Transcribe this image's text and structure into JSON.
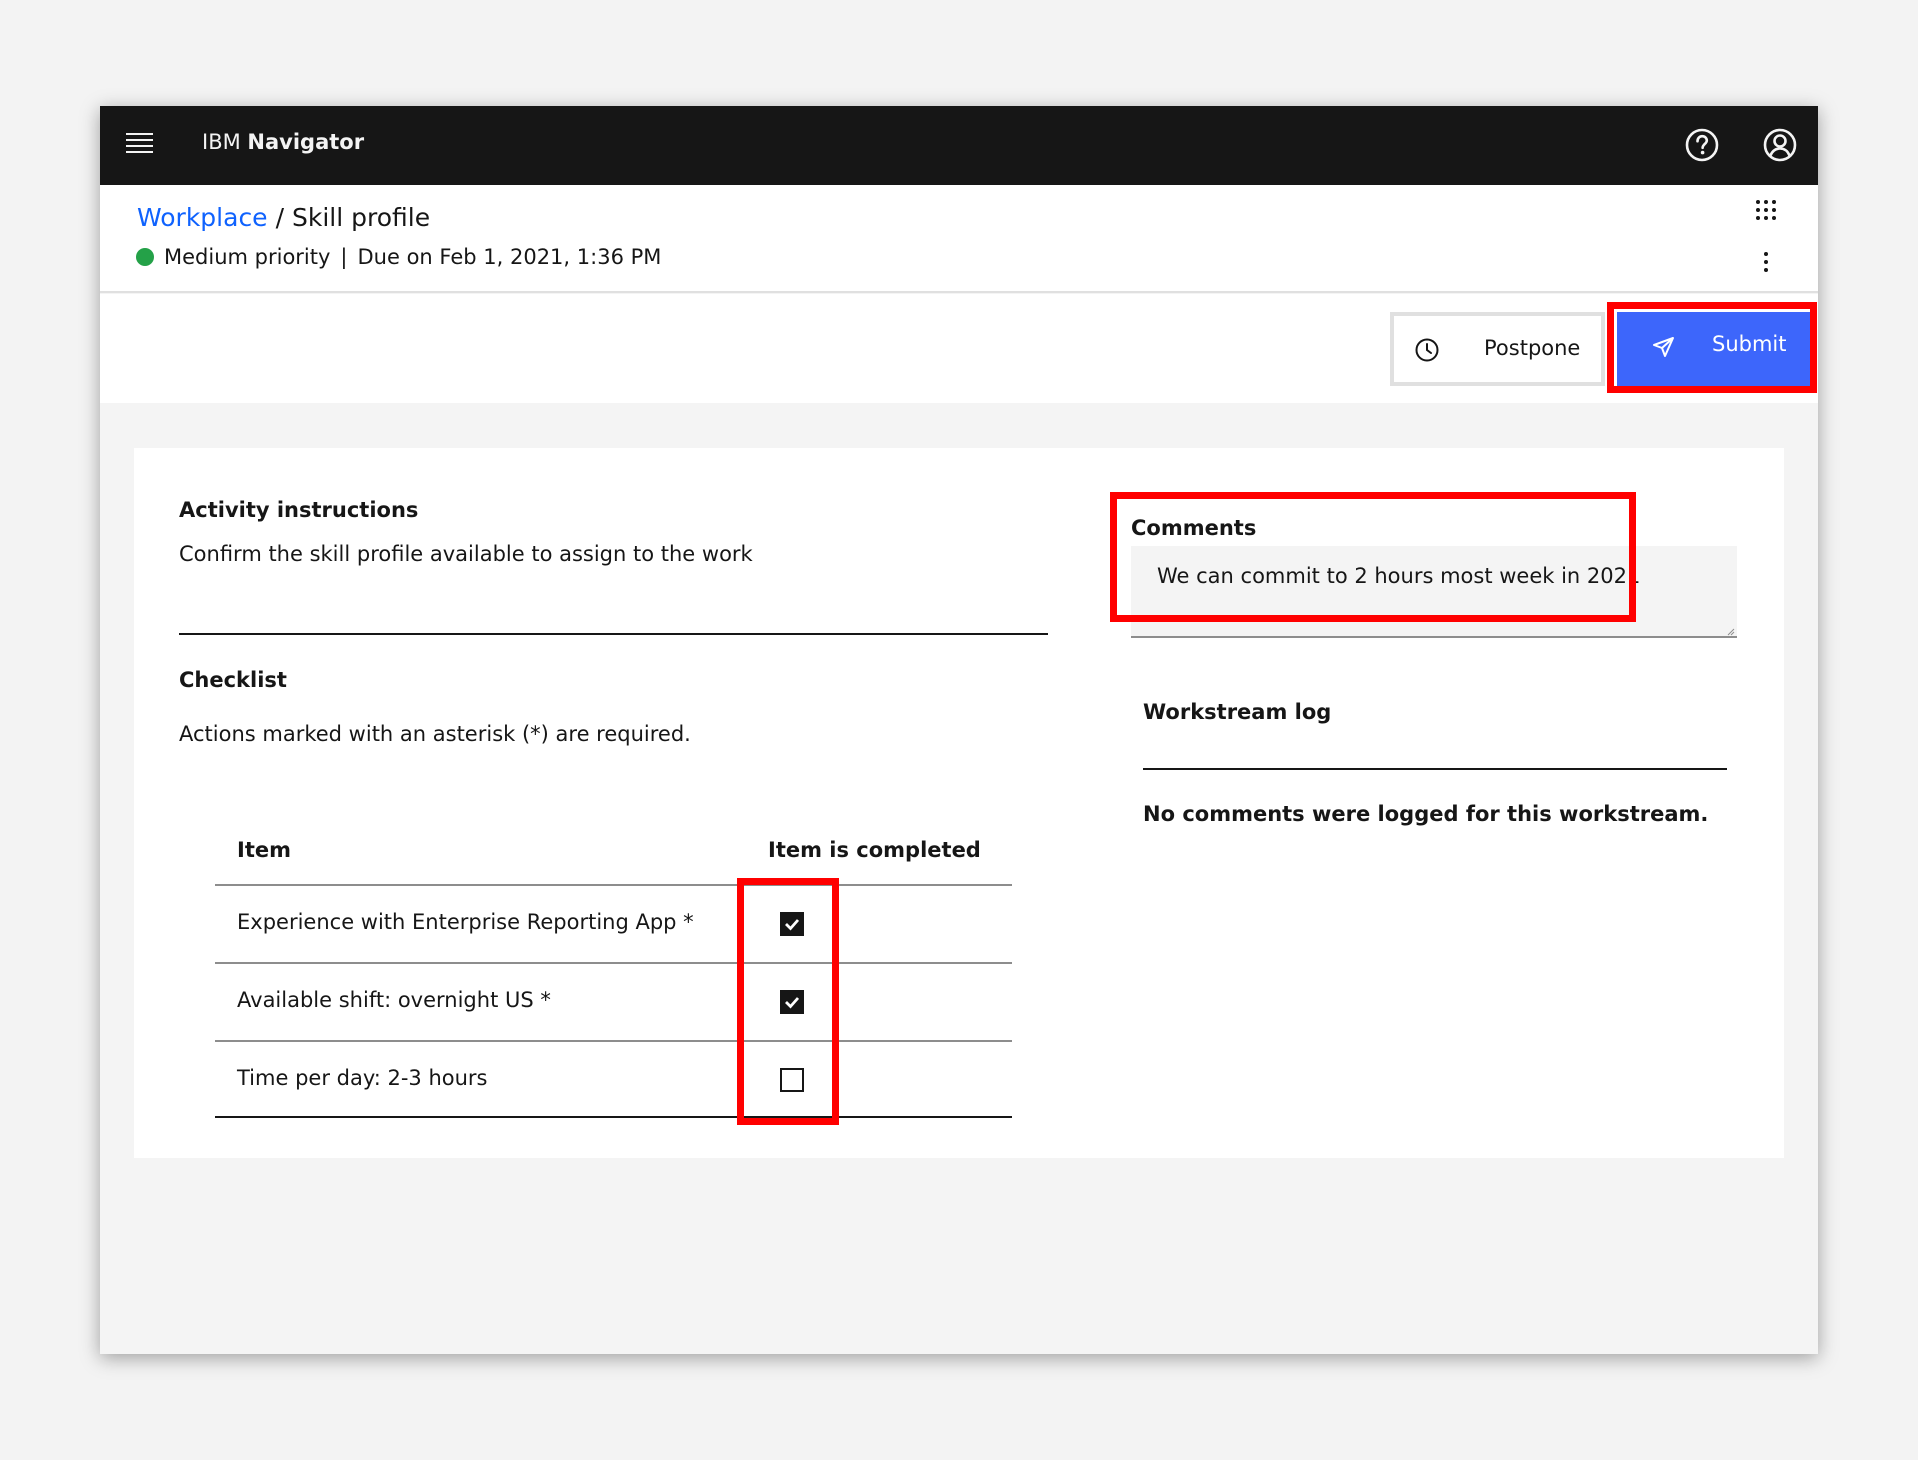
{
  "header": {
    "brand_prefix": "IBM",
    "brand_name": "Navigator",
    "menu_icon": "hamburger-menu-icon",
    "help_icon": "help-icon",
    "user_icon": "user-avatar-icon"
  },
  "breadcrumb": {
    "parent": "Workplace",
    "separator": "/",
    "current": "Skill profile"
  },
  "meta": {
    "priority": "Medium priority",
    "separator": "|",
    "due": "Due on Feb 1, 2021, 1:36 PM",
    "priority_color": "#24a148"
  },
  "actions": {
    "postpone_label": "Postpone",
    "submit_label": "Submit",
    "submit_color": "#3d66fb"
  },
  "instructions": {
    "title": "Activity instructions",
    "text": "Confirm the skill profile available to assign to the work"
  },
  "checklist": {
    "title": "Checklist",
    "note": "Actions marked with an asterisk (*) are required.",
    "columns": [
      "Item",
      "Item is completed"
    ],
    "rows": [
      {
        "item": "Experience with Enterprise Reporting App *",
        "completed": true
      },
      {
        "item": "Available shift: overnight US *",
        "completed": true
      },
      {
        "item": "Time per day: 2-3 hours",
        "completed": false
      }
    ]
  },
  "comments": {
    "label": "Comments",
    "value": "We can commit to 2 hours most week in 2021"
  },
  "workstream": {
    "title": "Workstream log",
    "empty_text": "No comments were logged for this workstream."
  },
  "highlight_color": "#ff0000"
}
